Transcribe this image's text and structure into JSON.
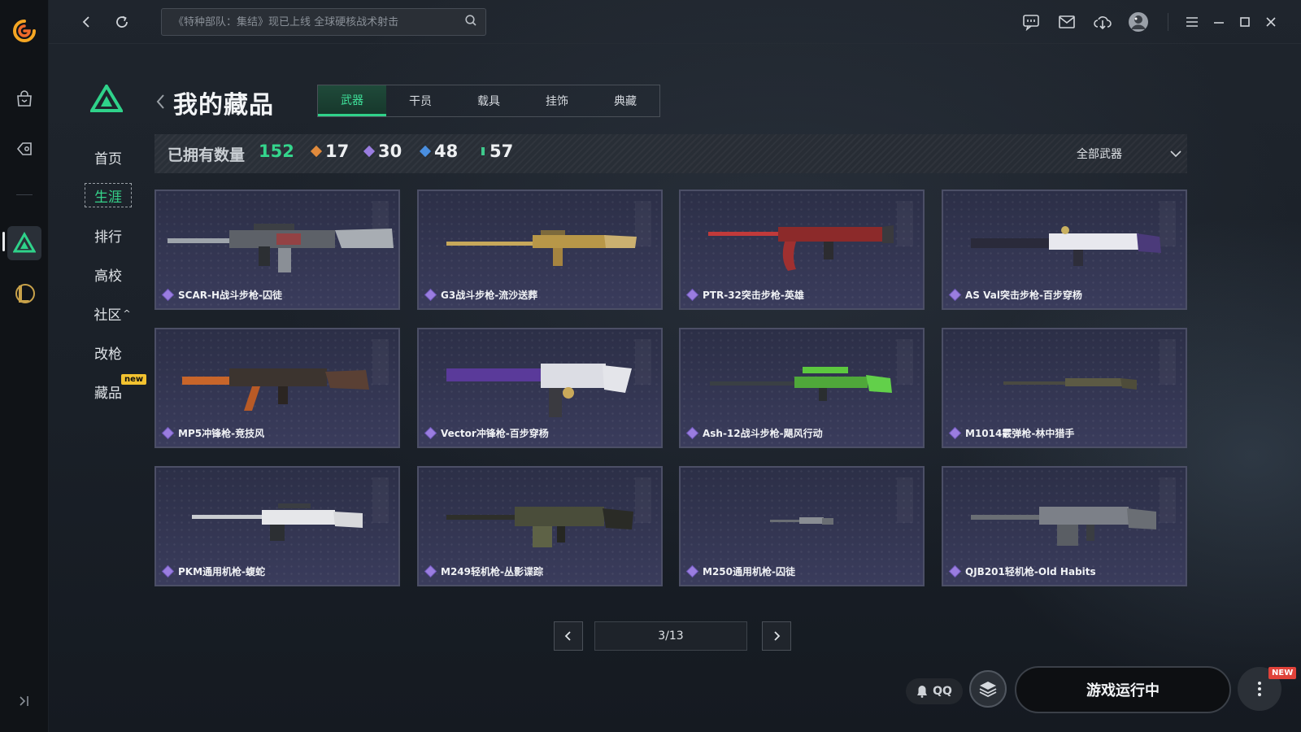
{
  "topbar": {
    "search_placeholder": "《特种部队：集结》现已上线 全球硬核战术射击",
    "icons": [
      "back-icon",
      "refresh-icon",
      "search-icon",
      "chat-icon",
      "mail-icon",
      "download-icon",
      "avatar",
      "menu-icon",
      "minimize-icon",
      "maximize-icon",
      "close-icon"
    ]
  },
  "rail": {
    "icons": [
      "app-logo",
      "store-icon",
      "game-tag-icon",
      "delta-force-icon",
      "league-icon"
    ]
  },
  "sidenav": {
    "items": [
      {
        "label": "首页"
      },
      {
        "label": "生涯"
      },
      {
        "label": "排行"
      },
      {
        "label": "高校"
      },
      {
        "label": "社区"
      },
      {
        "label": "改枪"
      },
      {
        "label": "藏品"
      }
    ],
    "community_caret": "^",
    "new_badge": "new"
  },
  "header": {
    "title": "我的藏品",
    "tabs": [
      {
        "label": "武器"
      },
      {
        "label": "干员"
      },
      {
        "label": "载具"
      },
      {
        "label": "挂饰"
      },
      {
        "label": "典藏"
      }
    ]
  },
  "stats": {
    "label": "已拥有数量",
    "total": "152",
    "rarities": [
      {
        "count": "17",
        "color": "#e08a3c"
      },
      {
        "count": "30",
        "color": "#9a7de0"
      },
      {
        "count": "48",
        "color": "#4a8fe0"
      },
      {
        "count": "57",
        "color": "#3ec98c"
      }
    ],
    "filter": "全部武器"
  },
  "items": [
    {
      "name": "SCAR-H战斗步枪-囚徒"
    },
    {
      "name": "G3战斗步枪-流沙送葬"
    },
    {
      "name": "PTR-32突击步枪-英雄"
    },
    {
      "name": "AS Val突击步枪-百步穿杨"
    },
    {
      "name": "MP5冲锋枪-竞技风"
    },
    {
      "name": "Vector冲锋枪-百步穿杨"
    },
    {
      "name": "Ash-12战斗步枪-飓风行动"
    },
    {
      "name": "M1014霰弹枪-林中猎手"
    },
    {
      "name": "PKM通用机枪-蝮蛇"
    },
    {
      "name": "M249轻机枪-丛影谍踪"
    },
    {
      "name": "M250通用机枪-囚徒"
    },
    {
      "name": "QJB201轻机枪-Old Habits"
    }
  ],
  "pagination": {
    "page": "3/13"
  },
  "bottom": {
    "qq": "QQ",
    "run": "游戏运行中",
    "new_tag": "NEW"
  }
}
